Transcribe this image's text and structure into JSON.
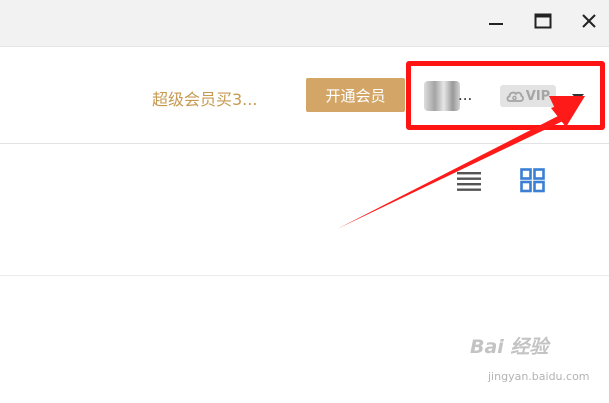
{
  "window": {
    "minimize_icon": "minimize-icon",
    "maximize_icon": "maximize-icon",
    "close_icon": "close-icon"
  },
  "header": {
    "promo_text": "超级会员买3...",
    "open_vip_label": "开通会员",
    "user": {
      "name": "...",
      "vip_badge": "VIP",
      "dropdown_icon": "caret-down-icon"
    }
  },
  "toolbar": {
    "list_view_icon": "list-view-icon",
    "grid_view_icon": "grid-view-icon"
  },
  "colors": {
    "gold": "#c79a52",
    "vip_button": "#d3a668",
    "highlight_red": "#ff1414",
    "grid_icon_blue": "#3b7fd4"
  },
  "watermark": {
    "logo": "Bai 经验",
    "url": "jingyan.baidu.com"
  }
}
